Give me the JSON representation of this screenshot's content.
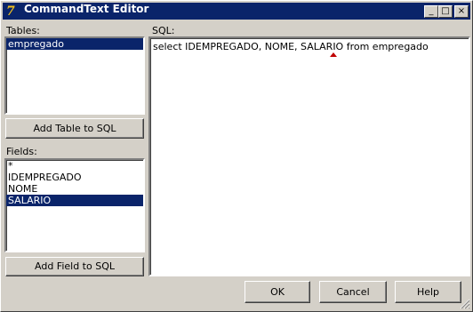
{
  "window": {
    "title": "CommandText Editor",
    "icon": "delphi-app-icon",
    "controls": {
      "minimize": "_",
      "maximize": "□",
      "close": "×"
    }
  },
  "tables": {
    "label": "Tables:",
    "items": [
      "empregado"
    ],
    "selected_index": 0,
    "add_button": "Add Table to SQL"
  },
  "fields": {
    "label": "Fields:",
    "items": [
      "*",
      "IDEMPREGADO",
      "NOME",
      "SALARIO"
    ],
    "selected_index": 3,
    "add_button": "Add Field to SQL"
  },
  "sql": {
    "label": "SQL:",
    "text": "select IDEMPREGADO, NOME, SALARIO from empregado"
  },
  "footer": {
    "ok": "OK",
    "cancel": "Cancel",
    "help": "Help"
  },
  "colors": {
    "titlebar": "#0a246a",
    "face": "#d4d0c8",
    "selection": "#0a246a"
  }
}
